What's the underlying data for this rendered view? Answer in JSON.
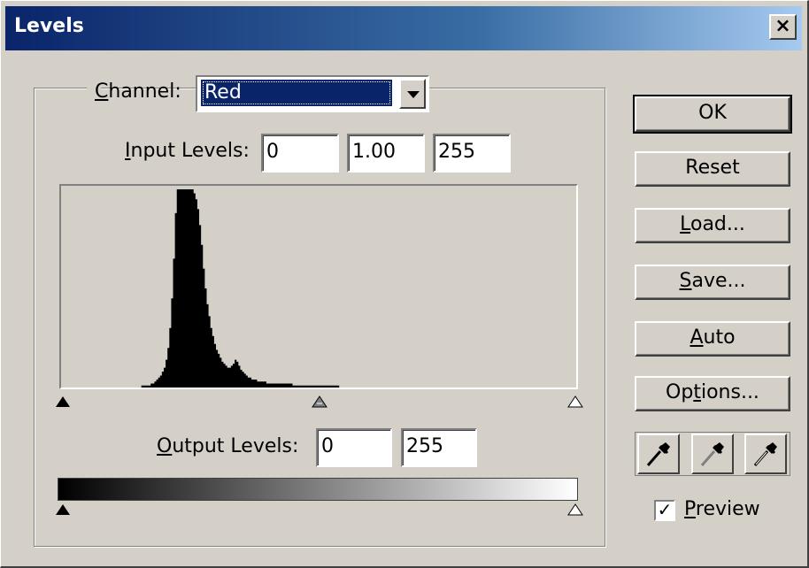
{
  "window": {
    "title": "Levels",
    "close_glyph": "×"
  },
  "channel": {
    "label": "Channel:",
    "value": "Red"
  },
  "input_levels": {
    "label": "Input Levels:",
    "shadows": "0",
    "gamma": "1.00",
    "highlights": "255"
  },
  "output_levels": {
    "label": "Output Levels:",
    "shadows": "0",
    "highlights": "255"
  },
  "histogram": {
    "values": [
      0,
      0,
      0,
      0,
      0,
      0,
      0,
      0,
      0,
      0,
      0,
      0,
      0,
      0,
      0,
      0,
      0,
      0,
      0,
      0,
      0,
      0,
      0,
      0,
      0,
      0,
      0,
      0,
      0,
      0,
      0,
      0,
      0,
      0,
      0,
      0,
      0,
      0,
      0,
      0,
      0,
      0,
      0,
      1,
      1,
      1,
      1,
      1,
      2,
      2,
      3,
      4,
      5,
      6,
      8,
      10,
      14,
      20,
      30,
      45,
      65,
      88,
      100,
      100,
      100,
      100,
      100,
      100,
      100,
      100,
      100,
      98,
      95,
      90,
      82,
      72,
      60,
      50,
      42,
      36,
      30,
      26,
      22,
      19,
      17,
      15,
      13,
      12,
      11,
      10,
      10,
      11,
      12,
      14,
      13,
      11,
      9,
      8,
      7,
      6,
      5,
      5,
      4,
      4,
      4,
      3,
      3,
      3,
      3,
      3,
      2,
      2,
      2,
      2,
      2,
      2,
      2,
      2,
      2,
      2,
      2,
      2,
      2,
      2,
      1,
      1,
      1,
      1,
      1,
      1,
      1,
      1,
      1,
      1,
      1,
      1,
      1,
      1,
      1,
      1,
      1,
      1,
      1,
      1,
      1,
      1,
      1,
      1,
      1,
      0,
      0,
      0,
      0,
      0,
      0,
      0,
      0,
      0,
      0,
      0,
      0,
      0,
      0,
      0,
      0,
      0,
      0,
      0,
      0,
      0,
      0,
      0,
      0,
      0,
      0,
      0,
      0,
      0,
      0,
      0,
      0,
      0,
      0,
      0,
      0,
      0,
      0,
      0,
      0,
      0,
      0,
      0,
      0,
      0,
      0,
      0,
      0,
      0,
      0,
      0,
      0,
      0,
      0,
      0,
      0,
      0,
      0,
      0,
      0,
      0,
      0,
      0,
      0,
      0,
      0,
      0,
      0,
      0,
      0,
      0,
      0,
      0,
      0,
      0,
      0,
      0,
      0,
      0,
      0,
      0,
      0,
      0,
      0,
      0,
      0,
      0,
      0,
      0,
      0,
      0,
      0,
      0,
      0,
      0,
      0,
      0,
      0,
      0,
      0,
      0,
      0,
      0,
      0,
      0,
      0,
      0,
      0,
      0,
      0,
      0,
      0,
      0,
      0,
      0,
      0,
      0,
      0,
      0,
      0,
      0,
      0,
      0,
      0,
      0,
      0,
      0
    ]
  },
  "buttons": {
    "ok": "OK",
    "reset": "Reset",
    "load": "Load...",
    "save": "Save...",
    "auto": "Auto",
    "options": "Options..."
  },
  "eyedroppers": [
    "set-black-point-eyedropper",
    "set-gray-point-eyedropper",
    "set-white-point-eyedropper"
  ],
  "preview": {
    "label": "Preview",
    "checked": true
  }
}
